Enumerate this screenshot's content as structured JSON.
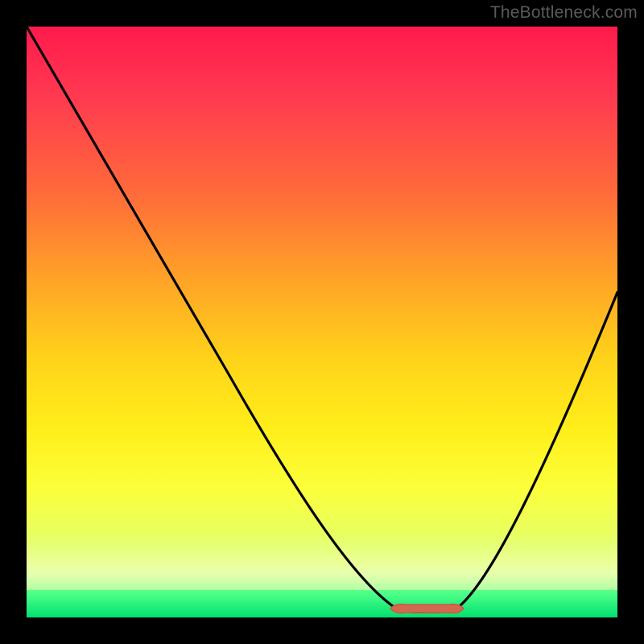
{
  "watermark": {
    "text": "TheBottleneck.com"
  },
  "colors": {
    "frame": "#000000",
    "gradient_top": "#ff1a4d",
    "gradient_bottom": "#00e070",
    "curve": "#000000",
    "bulge": "#d2694f",
    "watermark": "#5a5a5a"
  },
  "chart_data": {
    "type": "line",
    "title": "",
    "xlabel": "",
    "ylabel": "",
    "xlim": [
      0,
      100
    ],
    "ylim": [
      0,
      100
    ],
    "grid": false,
    "legend": false,
    "series": [
      {
        "name": "curve",
        "x": [
          0,
          5,
          10,
          15,
          20,
          25,
          30,
          35,
          40,
          45,
          50,
          55,
          60,
          62.5,
          65,
          67,
          71,
          73,
          75,
          78,
          82,
          86,
          90,
          94,
          98,
          100
        ],
        "values": [
          100,
          91,
          82,
          73,
          65,
          57,
          49,
          41,
          34,
          27,
          20,
          14,
          8,
          5,
          2.2,
          1.2,
          1.2,
          1.6,
          3,
          7.5,
          15,
          24,
          33,
          42,
          51,
          55
        ]
      }
    ],
    "annotations": [
      {
        "name": "optimal-range-marker",
        "type": "segment",
        "xrange": [
          62,
          73
        ],
        "y": 1.5
      }
    ]
  }
}
